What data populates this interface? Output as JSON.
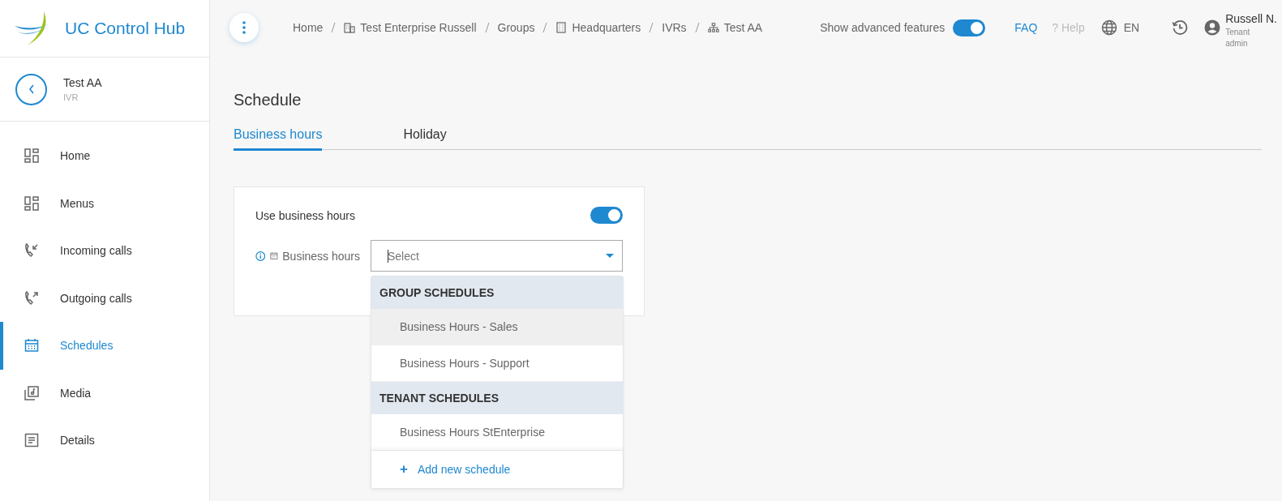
{
  "brand": {
    "name": "UC Control Hub"
  },
  "entity": {
    "title": "Test AA",
    "subtitle": "IVR"
  },
  "sidebar": {
    "items": [
      {
        "label": "Home",
        "kind": "grid",
        "selected": false
      },
      {
        "label": "Menus",
        "kind": "grid",
        "selected": false
      },
      {
        "label": "Incoming calls",
        "kind": "incoming",
        "selected": false
      },
      {
        "label": "Outgoing calls",
        "kind": "outgoing",
        "selected": false
      },
      {
        "label": "Schedules",
        "kind": "calendar",
        "selected": true
      },
      {
        "label": "Media",
        "kind": "media",
        "selected": false
      },
      {
        "label": "Details",
        "kind": "details",
        "selected": false
      }
    ]
  },
  "breadcrumbs": [
    {
      "label": "Home",
      "kind": "plain"
    },
    {
      "label": "Test Enterprise Russell",
      "kind": "enterprise"
    },
    {
      "label": "Groups",
      "kind": "plain"
    },
    {
      "label": "Headquarters",
      "kind": "building"
    },
    {
      "label": "IVRs",
      "kind": "plain"
    },
    {
      "label": "Test AA",
      "kind": "hierarchy"
    }
  ],
  "header": {
    "advanced_label": "Show advanced features",
    "advanced_on": true,
    "faq": "FAQ",
    "help_mark": "?",
    "help": "Help",
    "language": "EN",
    "user_name": "Russell N.",
    "user_role": "Tenant admin"
  },
  "page": {
    "title": "Schedule"
  },
  "tabs": [
    {
      "label": "Business hours",
      "selected": true
    },
    {
      "label": "Holiday",
      "selected": false
    }
  ],
  "form": {
    "use_label": "Use business hours",
    "use_on": true,
    "field_label": "Business hours",
    "placeholder": "Select"
  },
  "dropdown": {
    "groups": [
      {
        "title": "GROUP SCHEDULES",
        "options": [
          {
            "label": "Business Hours - Sales",
            "highlighted": true
          },
          {
            "label": "Business Hours - Support",
            "highlighted": false
          }
        ]
      },
      {
        "title": "TENANT SCHEDULES",
        "options": [
          {
            "label": "Business Hours StEnterprise",
            "highlighted": false
          }
        ]
      }
    ],
    "add_mark": "+",
    "add_label": "Add new schedule"
  }
}
